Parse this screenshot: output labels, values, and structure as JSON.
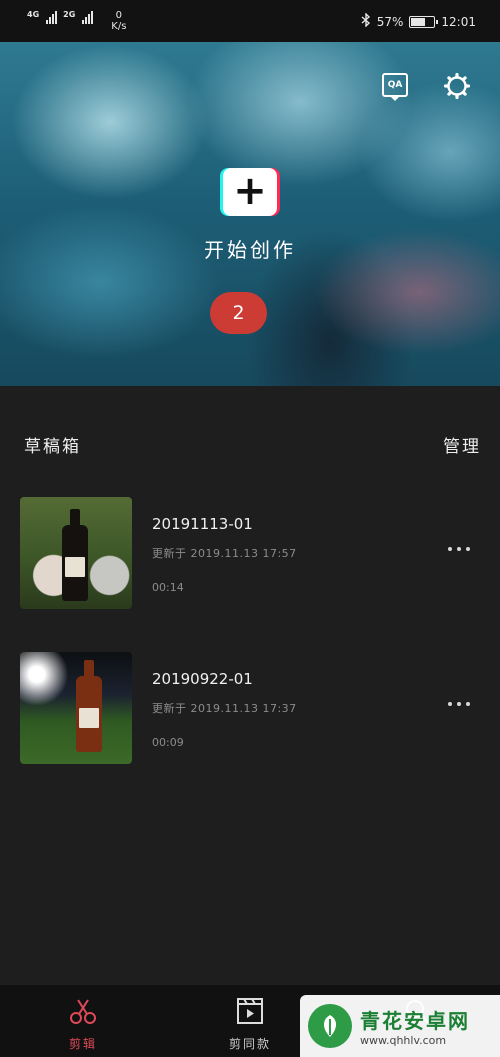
{
  "status_bar": {
    "network_1": "4G",
    "network_2": "2G",
    "speed_value": "0",
    "speed_unit": "K/s",
    "battery_percent": "57%",
    "time": "12:01",
    "icons": [
      "signal-icon",
      "bluetooth-icon",
      "battery-icon"
    ]
  },
  "hero": {
    "qa_label": "QA",
    "create_symbol": "+",
    "create_label": "开始创作",
    "count_badge": "2"
  },
  "drafts": {
    "title": "草稿箱",
    "manage_label": "管理",
    "items": [
      {
        "title": "20191113-01",
        "updated": "更新于 2019.11.13 17:57",
        "duration": "00:14"
      },
      {
        "title": "20190922-01",
        "updated": "更新于 2019.11.13 17:37",
        "duration": "00:09"
      }
    ]
  },
  "tabbar": {
    "tabs": [
      {
        "label": "剪辑",
        "icon": "scissors-icon",
        "active": true
      },
      {
        "label": "剪同款",
        "icon": "clapperboard-icon",
        "active": false
      },
      {
        "label": "",
        "icon": "search-icon",
        "active": false
      }
    ]
  },
  "watermark": {
    "name": "青花安卓网",
    "url": "www.qhhlv.com"
  },
  "colors": {
    "accent": "#e04a58",
    "badge": "#cd3b35",
    "background": "#1e1e1e"
  }
}
